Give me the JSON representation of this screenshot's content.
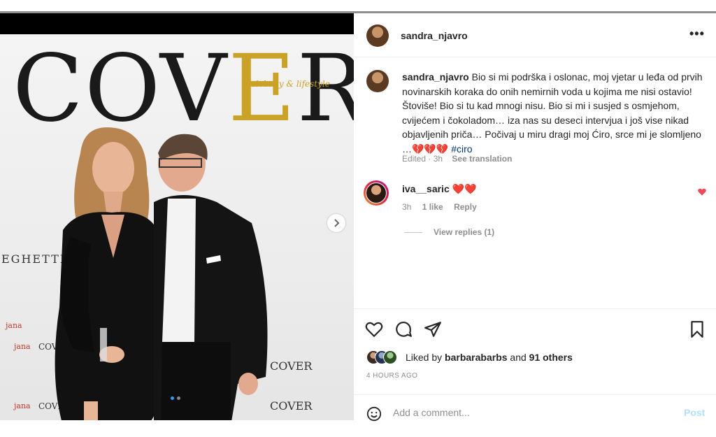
{
  "post": {
    "username": "sandra_njavro",
    "more_label": "•••",
    "image": {
      "logo_main": "COV",
      "logo_gold": "E",
      "logo_end": "R",
      "logo_sub": "celebrity & lifestyle",
      "brand_left": "EGHETTI",
      "brand_cover_a": "COVER",
      "brand_cover_b": "COVER",
      "brand_jana_a": "jana",
      "brand_jana_b": "jana",
      "brand_jana_c": "jana",
      "brand_cov_a": "COV",
      "brand_cov_b": "COVER",
      "carousel_total": 2,
      "carousel_active": 1
    },
    "caption": {
      "username": "sandra_njavro",
      "text": " Bio si mi podrška i oslonac, moj vjetar u leđa od prvih novinarskih koraka do onih nemirnih voda u kojima me nisi ostavio! Štoviše! Bio si tu kad mnogi nisu. Bio si mi i susjed s osmjehom, cvijećem i čokoladom… iza nas su deseci intervjua i još vise nikad objavljenih priča… Počivaj u miru dragi moj Ćiro, srce mi je slomljeno …💔💔💔 ",
      "hashtag": "#ciro",
      "edited": "Edited · 3h",
      "see_translation": "See translation"
    },
    "comment": {
      "username": "iva__saric",
      "hearts": "❤️❤️",
      "time": "3h",
      "likes": "1 like",
      "reply": "Reply",
      "view_replies": "View replies (1)"
    },
    "likes": {
      "prefix": "Liked by ",
      "user": "barbarabarbs",
      "middle": " and ",
      "others": "91 others"
    },
    "timestamp": "4 HOURS AGO",
    "add_comment": {
      "placeholder": "Add a comment...",
      "post_label": "Post"
    }
  },
  "icons": {
    "like": "heart-icon",
    "comment": "comment-icon",
    "share": "paper-plane-icon",
    "save": "bookmark-icon",
    "emoji": "smiley-icon",
    "next": "chevron-right-icon",
    "comment_like": "heart-filled-icon"
  },
  "colors": {
    "link_blue": "#00376b",
    "post_disabled": "#b2dffc",
    "heart_red": "#ed4956",
    "gold": "#c9a227"
  }
}
